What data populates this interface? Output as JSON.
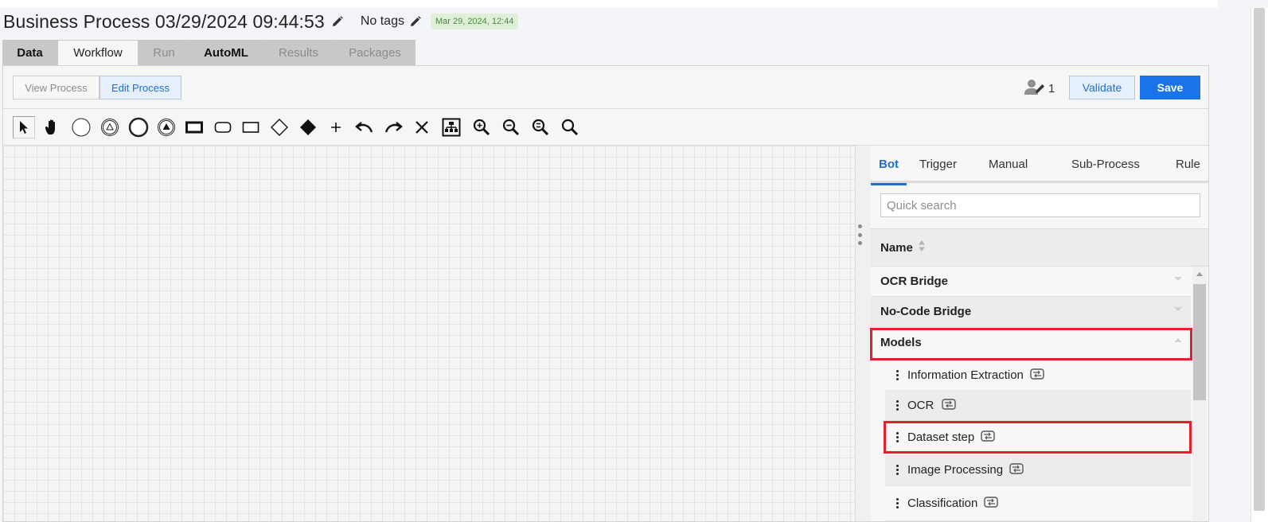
{
  "header": {
    "title": "Business Process 03/29/2024 09:44:53",
    "tags": "No tags",
    "date_badge": "Mar 29, 2024, 12:44"
  },
  "tabs": [
    {
      "label": "Data",
      "state": "normal"
    },
    {
      "label": "Workflow",
      "state": "active"
    },
    {
      "label": "Run",
      "state": "disabled"
    },
    {
      "label": "AutoML",
      "state": "normal"
    },
    {
      "label": "Results",
      "state": "disabled"
    },
    {
      "label": "Packages",
      "state": "disabled"
    }
  ],
  "mode": {
    "view_label": "View Process",
    "edit_label": "Edit Process",
    "active": "Edit Process"
  },
  "actions": {
    "editor_count": "1",
    "validate_label": "Validate",
    "save_label": "Save"
  },
  "toolbar": {
    "tools": [
      "pointer-tool",
      "hand-tool",
      "start-event-tool",
      "message-event-tool",
      "end-event-tool",
      "signal-event-tool",
      "task-tool",
      "subprocess-tool",
      "rectangle-tool",
      "gateway-tool",
      "exclusive-gateway-tool",
      "add-tool",
      "undo-tool",
      "redo-tool",
      "delete-tool",
      "auto-layout-tool",
      "zoom-in-tool",
      "zoom-out-tool",
      "zoom-reset-tool",
      "zoom-fit-tool"
    ],
    "selected": "pointer-tool"
  },
  "palette": {
    "tabs": [
      "Bot",
      "Trigger",
      "Manual",
      "Sub-Process",
      "Rule"
    ],
    "active_tab": "Bot",
    "search_placeholder": "Quick search",
    "column_header": "Name",
    "groups": [
      "OCR Bridge",
      "No-Code Bridge",
      "Models"
    ],
    "items": [
      "Information Extraction",
      "OCR",
      "Dataset step",
      "Image Processing",
      "Classification"
    ]
  },
  "colors": {
    "accent": "#1a73e8",
    "highlight": "#e0202a",
    "badge_bg": "#dff0d8",
    "badge_text": "#4a8a3d"
  }
}
